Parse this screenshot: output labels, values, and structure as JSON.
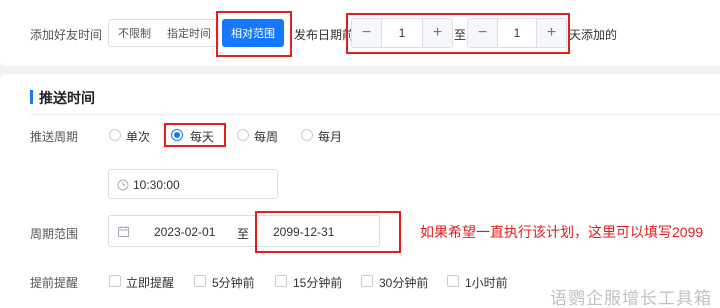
{
  "friend_time": {
    "label": "添加好友时间",
    "options": [
      "不限制",
      "指定时间",
      "相对范围"
    ],
    "prefix": "发布日期前",
    "from_value": "1",
    "to_sep": "至",
    "to_value": "1",
    "suffix": "天添加的",
    "minus": "−",
    "plus": "+"
  },
  "push": {
    "section_title": "推送时间",
    "cycle_label": "推送周期",
    "cycle_options": [
      "单次",
      "每天",
      "每周",
      "每月"
    ],
    "cycle_selected": "每天",
    "time_value": "10:30:00",
    "range_label": "周期范围",
    "range_start": "2023-02-01",
    "range_sep": "至",
    "range_end": "2099-12-31",
    "remind_label": "提前提醒",
    "remind_options": [
      "立即提醒",
      "5分钟前",
      "15分钟前",
      "30分钟前",
      "1小时前"
    ]
  },
  "annotation": "如果希望一直执行该计划，这里可以填写2099",
  "watermark": "语鹦企服增长工具箱",
  "colors": {
    "accent": "#1677ff",
    "annotation": "#e02020"
  }
}
